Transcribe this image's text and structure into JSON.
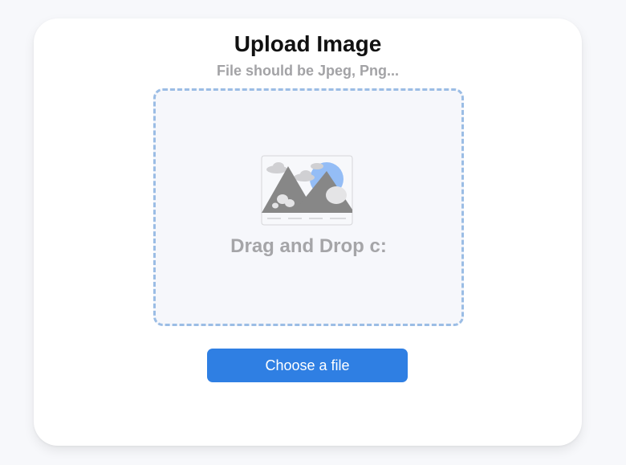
{
  "upload": {
    "title": "Upload Image",
    "subtitle": "File should be Jpeg, Png...",
    "drop_label": "Drag and Drop c:",
    "choose_label": "Choose a file",
    "illustration_icon": "image-placeholder-icon"
  },
  "colors": {
    "background": "#f7f8fb",
    "card": "#ffffff",
    "dropzone_border": "#9bbde5",
    "dropzone_fill": "#f6f7fb",
    "accent": "#2f7fe3",
    "muted_text": "#a3a3a6",
    "sun": "#94bdf6",
    "mountain": "#878787"
  }
}
